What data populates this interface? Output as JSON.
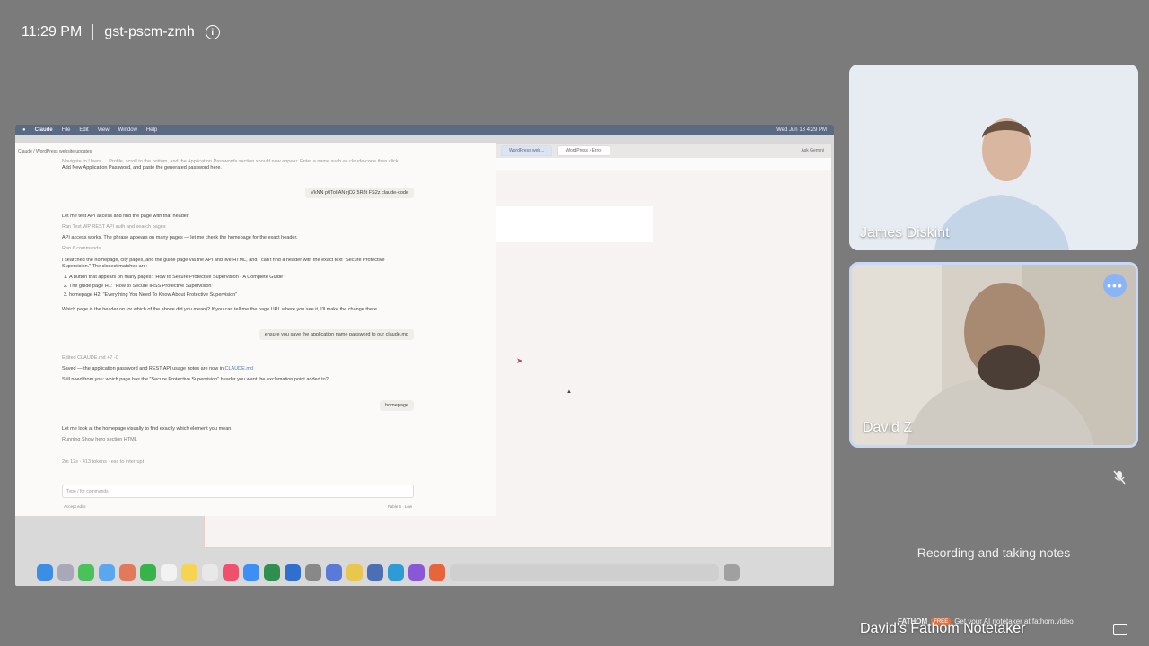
{
  "meeting": {
    "time": "11:29 PM",
    "code": "gst-pscm-zmh"
  },
  "screen": {
    "menubar": {
      "app": "Claude",
      "items": [
        "File",
        "Edit",
        "View",
        "Window",
        "Help"
      ],
      "clock": "Wed Jun 18  4:29 PM"
    },
    "browser": {
      "tabs": [
        "WordPress web...",
        "WordPress › Error"
      ],
      "gemini": "Ask Gemini"
    },
    "claude": {
      "breadcrumb": "Claude / WordPress website updates",
      "lines": {
        "intro_a": "Navigate to Users → Profile, scroll to the bottom, and the Application Passwords section should now appear. Enter a name such as claude-code then click",
        "intro_b": "Add New Application Password, and paste the generated password here.",
        "user_pw": "VkNN p0ToIlAN rjD2 5R8t FS2z claude-code",
        "test_api": "Let me test API access and find the page with that header.",
        "ran_test": "Ran Test WP REST API auth and search pages",
        "api_works": "API access works. The phrase appears on many pages — let me check the homepage for the exact header.",
        "ran_cmds": "Ran 6 commands",
        "searched": "I searched the homepage, city pages, and the guide page via the API and live HTML, and I can't find a header with the exact text \"Secure Protective",
        "searched_b": "Supervision.\" The closest matches are:",
        "which_page": "Which page is the header on (or which of the above did you mean)? If you can tell me the page URL where you see it, I'll make the change there.",
        "user_save": "ensure you save the application name password to our claude.md",
        "edited": "Edited CLAUDE.md +7 -0",
        "saved_a": "Saved — the application password and REST API usage notes are now in",
        "saved_link": "CLAUDE.md",
        "still_need": "Still need from you: which page has the \"Secure Protective Supervision\" header you want the exclamation point added to?",
        "user_home": "homepage",
        "look": "Let me look at the homepage visually to find exactly which element you mean.",
        "running": "Running Show hero section HTML",
        "status": "2m 12s · 413 tokens · esc to interrupt"
      },
      "matches": [
        "A button that appears on many pages: \"How to Secure Protective Supervision - A Complete Guide\"",
        "The guide page H1: \"How to Secure IHSS Protective Supervision\"",
        "homepage H2: \"Everything You Need To Know About Protective Supervision\""
      ],
      "input_placeholder": "Type / for commands",
      "footer_left": "Accept edits",
      "footer_right_a": "Fable 5",
      "footer_right_b": "Low"
    }
  },
  "participants": [
    {
      "name": "James Diskint"
    },
    {
      "name": "David Z"
    },
    {
      "name": "David's Fathom Notetaker",
      "status": "Recording and taking notes",
      "fathom_brand": "FATHOM",
      "fathom_badge": "FREE",
      "fathom_tagline": "Get your AI notetaker at fathom.video"
    }
  ],
  "colors": {
    "background": "#7b7b7b",
    "active_border": "#c7d8f4",
    "more_button": "#8ab4f8"
  }
}
